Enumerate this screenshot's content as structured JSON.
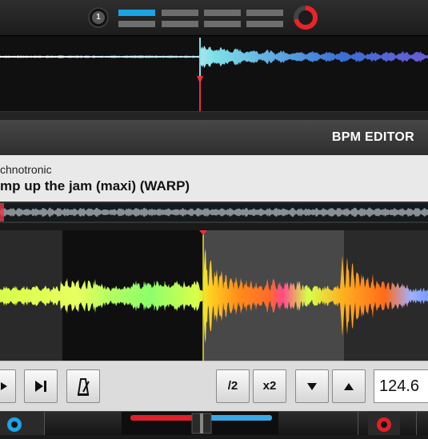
{
  "deck": {
    "number": "1",
    "slot_layout": "2 rows x 4 columns; first top slot active",
    "accent_color": "#1aa4e6",
    "ring_color": "#e8232b"
  },
  "overview": {
    "playhead_color": "#e8333a",
    "wave_colors": [
      "#ffffff",
      "#7fd6e8",
      "#3a6fd6",
      "#6a5cd6"
    ]
  },
  "editor": {
    "title": "BPM EDITOR"
  },
  "track": {
    "artist": "chnotronic",
    "title": "mp up the jam (maxi) (WARP)"
  },
  "mini_wave": {
    "marker_color": "#e83a4a",
    "wave_color": "#8a8f94"
  },
  "main_wave": {
    "beat_marker_color": "#e8e020",
    "region_colors": [
      "#2a2a2a",
      "#111111",
      "#4a4a4a",
      "#2a2a2a"
    ],
    "wave_colors": [
      "#d8ff4a",
      "#8cff6a",
      "#ffb020",
      "#ff6a1a",
      "#ff4a8a",
      "#7a9cff"
    ]
  },
  "controls": {
    "prev_icon": "play-triangle-icon",
    "skip_icon": "skip-next-icon",
    "metronome_icon": "metronome-icon",
    "half_label": "/2",
    "double_label": "x2",
    "down_icon": "arrow-down-icon",
    "up_icon": "arrow-up-icon",
    "bpm_value": "124.6"
  },
  "crossfader": {
    "left_color": "#e0202a",
    "right_color": "#3aa8e8"
  }
}
